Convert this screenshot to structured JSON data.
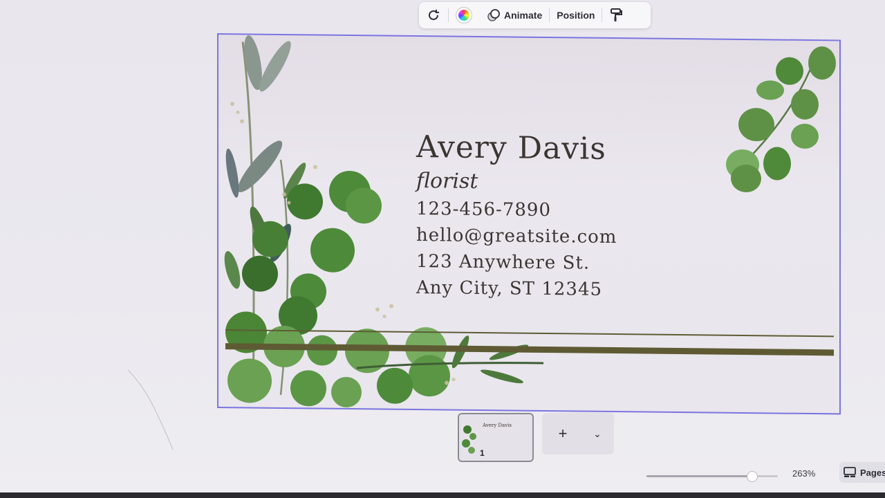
{
  "toolbar": {
    "animate_label": "Animate",
    "position_label": "Position",
    "icons": [
      "rotate-icon",
      "color-wheel-icon",
      "animate-icon",
      "paint-roller-icon"
    ]
  },
  "card": {
    "name": "Avery Davis",
    "title": "florist",
    "phone": "123-456-7890",
    "email": "hello@greatsite.com",
    "address1": "123 Anywhere St.",
    "address2": "Any City, ST 12345",
    "accent": "#5e5b34",
    "selection_color": "#7b74e0"
  },
  "pages": {
    "thumb_number": "1",
    "thumb_name": "Avery Davis",
    "add_symbol": "+"
  },
  "status": {
    "zoom": "263%",
    "zoom_fraction": 0.8,
    "pages_label": "Pages"
  }
}
